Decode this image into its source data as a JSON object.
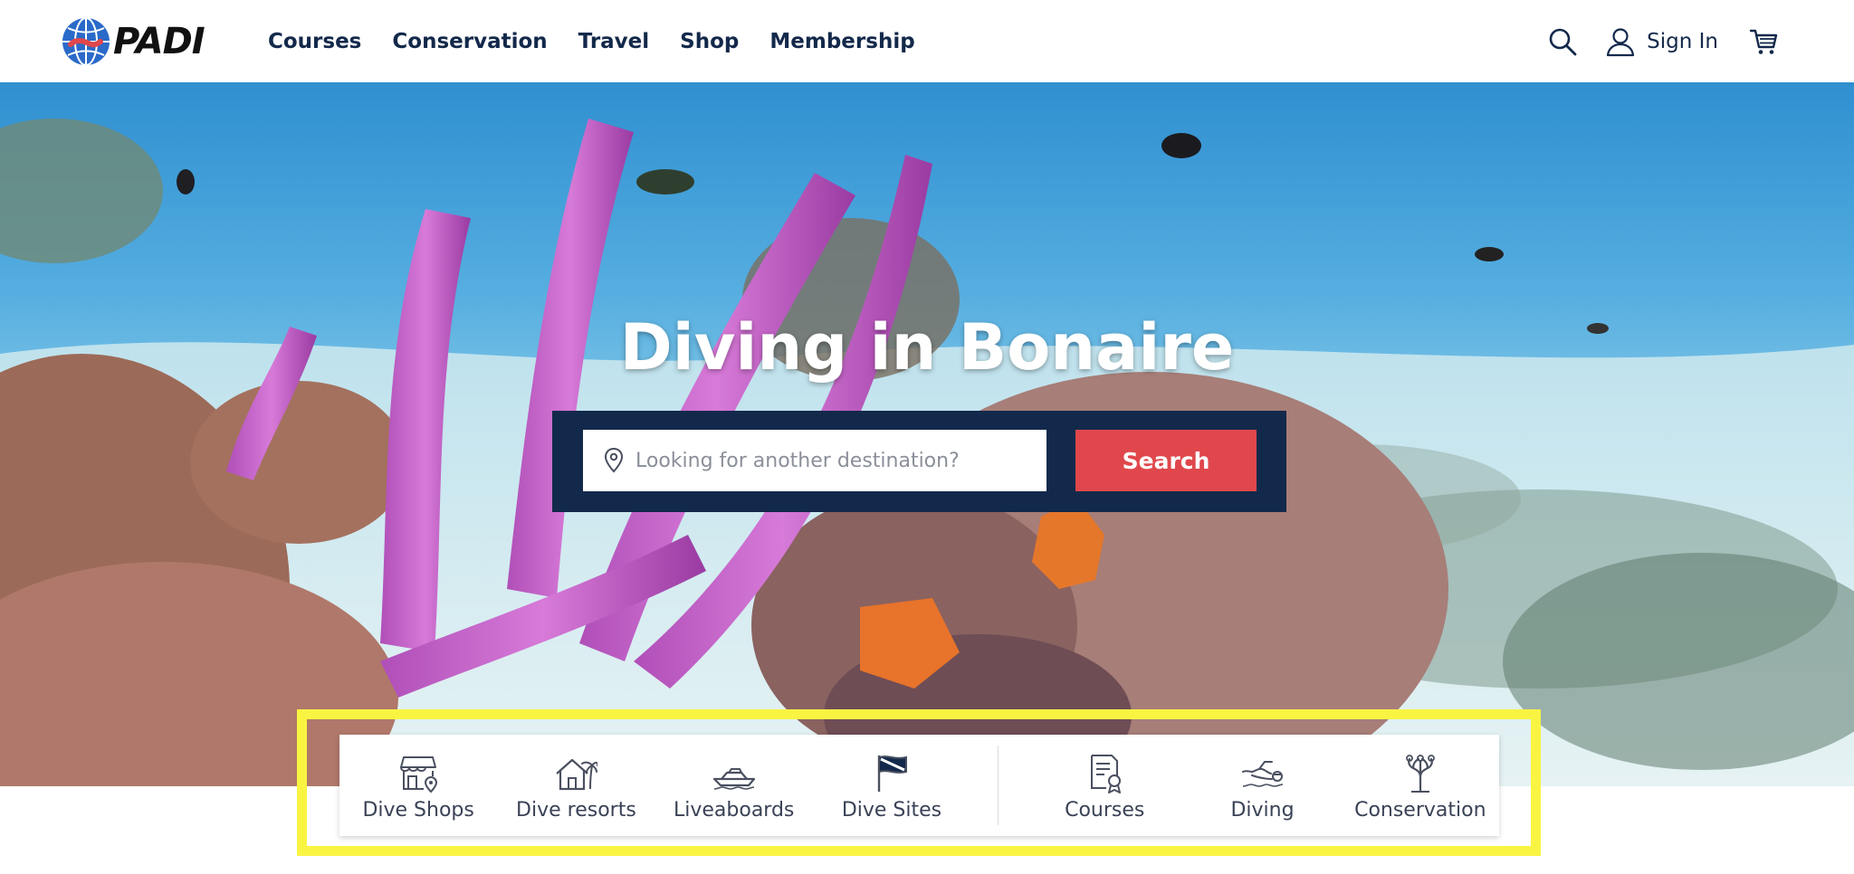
{
  "header": {
    "logo_text": "PADI",
    "nav": [
      "Courses",
      "Conservation",
      "Travel",
      "Shop",
      "Membership"
    ],
    "sign_in_label": "Sign In",
    "icons": [
      "search-icon",
      "user-icon",
      "cart-icon"
    ]
  },
  "hero": {
    "title": "Diving in Bonaire",
    "search_placeholder": "Looking for another destination?",
    "search_button": "Search"
  },
  "categories": {
    "group1": [
      {
        "label": "Dive Shops",
        "icon": "dive-shop-icon"
      },
      {
        "label": "Dive resorts",
        "icon": "dive-resort-icon"
      },
      {
        "label": "Liveaboards",
        "icon": "liveaboard-boat-icon"
      },
      {
        "label": "Dive Sites",
        "icon": "dive-flag-icon"
      }
    ],
    "group2": [
      {
        "label": "Courses",
        "icon": "certificate-icon"
      },
      {
        "label": "Diving",
        "icon": "diver-icon"
      },
      {
        "label": "Conservation",
        "icon": "coral-icon"
      }
    ]
  },
  "colors": {
    "navy": "#13294b",
    "search_red": "#e0474c",
    "highlight_yellow": "#f9f442"
  }
}
